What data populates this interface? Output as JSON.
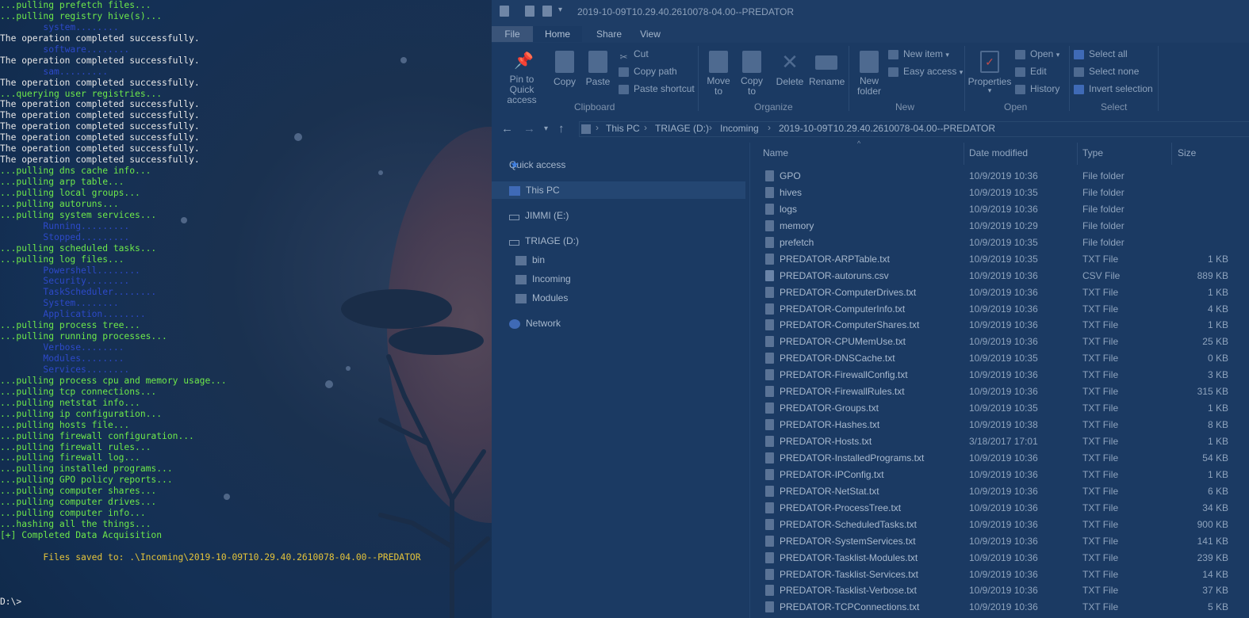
{
  "terminal": {
    "lines": [
      {
        "text": "...pulling prefetch files...",
        "color": "green"
      },
      {
        "text": "...pulling registry hive(s)...",
        "color": "green"
      },
      {
        "text": "        system........",
        "color": "blue"
      },
      {
        "text": "The operation completed successfully.",
        "color": "white"
      },
      {
        "text": "        software........",
        "color": "blue"
      },
      {
        "text": "The operation completed successfully.",
        "color": "white"
      },
      {
        "text": "        sam.........",
        "color": "blue"
      },
      {
        "text": "The operation completed successfully.",
        "color": "white"
      },
      {
        "text": "...querying user registries...",
        "color": "green"
      },
      {
        "text": "The operation completed successfully.",
        "color": "white"
      },
      {
        "text": "The operation completed successfully.",
        "color": "white"
      },
      {
        "text": "The operation completed successfully.",
        "color": "white"
      },
      {
        "text": "The operation completed successfully.",
        "color": "white"
      },
      {
        "text": "The operation completed successfully.",
        "color": "white"
      },
      {
        "text": "The operation completed successfully.",
        "color": "white"
      },
      {
        "text": "...pulling dns cache info...",
        "color": "green"
      },
      {
        "text": "...pulling arp table...",
        "color": "green"
      },
      {
        "text": "...pulling local groups...",
        "color": "green"
      },
      {
        "text": "...pulling autoruns...",
        "color": "green"
      },
      {
        "text": "...pulling system services...",
        "color": "green"
      },
      {
        "text": "        Running.........",
        "color": "blue"
      },
      {
        "text": "        Stopped.........",
        "color": "blue"
      },
      {
        "text": "...pulling scheduled tasks...",
        "color": "green"
      },
      {
        "text": "...pulling log files...",
        "color": "green"
      },
      {
        "text": "        Powershell........",
        "color": "blue"
      },
      {
        "text": "        Security........",
        "color": "blue"
      },
      {
        "text": "        TaskScheduler........",
        "color": "blue"
      },
      {
        "text": "        System........",
        "color": "blue"
      },
      {
        "text": "        Application........",
        "color": "blue"
      },
      {
        "text": "...pulling process tree...",
        "color": "green"
      },
      {
        "text": "...pulling running processes...",
        "color": "green"
      },
      {
        "text": "        Verbose........",
        "color": "blue"
      },
      {
        "text": "        Modules........",
        "color": "blue"
      },
      {
        "text": "        Services........",
        "color": "blue"
      },
      {
        "text": "...pulling process cpu and memory usage...",
        "color": "green"
      },
      {
        "text": "...pulling tcp connections...",
        "color": "green"
      },
      {
        "text": "...pulling netstat info...",
        "color": "green"
      },
      {
        "text": "...pulling ip configuration...",
        "color": "green"
      },
      {
        "text": "...pulling hosts file...",
        "color": "green"
      },
      {
        "text": "...pulling firewall configuration...",
        "color": "green"
      },
      {
        "text": "...pulling firewall rules...",
        "color": "green"
      },
      {
        "text": "...pulling firewall log...",
        "color": "green"
      },
      {
        "text": "...pulling installed programs...",
        "color": "green"
      },
      {
        "text": "...pulling GPO policy reports...",
        "color": "green"
      },
      {
        "text": "...pulling computer shares...",
        "color": "green"
      },
      {
        "text": "...pulling computer drives...",
        "color": "green"
      },
      {
        "text": "...pulling computer info...",
        "color": "green"
      },
      {
        "text": "...hashing all the things...",
        "color": "green"
      },
      {
        "text": "[+] Completed Data Acquisition",
        "color": "green"
      },
      {
        "text": "",
        "color": "white"
      },
      {
        "text": "        Files saved to: .\\Incoming\\2019-10-09T10.29.40.2610078-04.00--PREDATOR",
        "color": "yellow"
      },
      {
        "text": "",
        "color": "white"
      },
      {
        "text": "",
        "color": "white"
      },
      {
        "text": "",
        "color": "white"
      },
      {
        "text": "D:\\>",
        "color": "white"
      }
    ]
  },
  "explorer": {
    "title": "2019-10-09T10.29.40.2610078-04.00--PREDATOR",
    "tabs": {
      "file": "File",
      "home": "Home",
      "share": "Share",
      "view": "View"
    },
    "ribbon": {
      "pin": "Pin to Quick\naccess",
      "copy": "Copy",
      "paste": "Paste",
      "cut": "Cut",
      "copy_path": "Copy path",
      "paste_shortcut": "Paste shortcut",
      "move_to": "Move\nto",
      "copy_to": "Copy\nto",
      "delete": "Delete",
      "rename": "Rename",
      "new_folder": "New\nfolder",
      "new_item": "New item",
      "easy_access": "Easy access",
      "properties": "Properties",
      "open": "Open",
      "edit": "Edit",
      "history": "History",
      "select_all": "Select all",
      "select_none": "Select none",
      "invert_selection": "Invert selection",
      "groups": {
        "clipboard": "Clipboard",
        "organize": "Organize",
        "new": "New",
        "open": "Open",
        "select": "Select"
      }
    },
    "breadcrumb": [
      "This PC",
      "TRIAGE (D:)",
      "Incoming",
      "2019-10-09T10.29.40.2610078-04.00--PREDATOR"
    ],
    "nav": {
      "quick_access": "Quick access",
      "this_pc": "This PC",
      "jimmi": "JIMMI (E:)",
      "triage": "TRIAGE (D:)",
      "bin": "bin",
      "incoming": "Incoming",
      "modules": "Modules",
      "network": "Network"
    },
    "columns": {
      "name": "Name",
      "date": "Date modified",
      "type": "Type",
      "size": "Size"
    },
    "files": [
      {
        "name": "GPO",
        "date": "10/9/2019 10:36",
        "type": "File folder",
        "size": "",
        "kind": "folder"
      },
      {
        "name": "hives",
        "date": "10/9/2019 10:35",
        "type": "File folder",
        "size": "",
        "kind": "folder"
      },
      {
        "name": "logs",
        "date": "10/9/2019 10:36",
        "type": "File folder",
        "size": "",
        "kind": "folder"
      },
      {
        "name": "memory",
        "date": "10/9/2019 10:29",
        "type": "File folder",
        "size": "",
        "kind": "folder"
      },
      {
        "name": "prefetch",
        "date": "10/9/2019 10:35",
        "type": "File folder",
        "size": "",
        "kind": "folder"
      },
      {
        "name": "PREDATOR-ARPTable.txt",
        "date": "10/9/2019 10:35",
        "type": "TXT File",
        "size": "1 KB",
        "kind": "txt"
      },
      {
        "name": "PREDATOR-autoruns.csv",
        "date": "10/9/2019 10:36",
        "type": "CSV File",
        "size": "889 KB",
        "kind": "doc"
      },
      {
        "name": "PREDATOR-ComputerDrives.txt",
        "date": "10/9/2019 10:36",
        "type": "TXT File",
        "size": "1 KB",
        "kind": "txt"
      },
      {
        "name": "PREDATOR-ComputerInfo.txt",
        "date": "10/9/2019 10:36",
        "type": "TXT File",
        "size": "4 KB",
        "kind": "txt"
      },
      {
        "name": "PREDATOR-ComputerShares.txt",
        "date": "10/9/2019 10:36",
        "type": "TXT File",
        "size": "1 KB",
        "kind": "txt"
      },
      {
        "name": "PREDATOR-CPUMemUse.txt",
        "date": "10/9/2019 10:36",
        "type": "TXT File",
        "size": "25 KB",
        "kind": "txt"
      },
      {
        "name": "PREDATOR-DNSCache.txt",
        "date": "10/9/2019 10:35",
        "type": "TXT File",
        "size": "0 KB",
        "kind": "txt"
      },
      {
        "name": "PREDATOR-FirewallConfig.txt",
        "date": "10/9/2019 10:36",
        "type": "TXT File",
        "size": "3 KB",
        "kind": "txt"
      },
      {
        "name": "PREDATOR-FirewallRules.txt",
        "date": "10/9/2019 10:36",
        "type": "TXT File",
        "size": "315 KB",
        "kind": "txt"
      },
      {
        "name": "PREDATOR-Groups.txt",
        "date": "10/9/2019 10:35",
        "type": "TXT File",
        "size": "1 KB",
        "kind": "txt"
      },
      {
        "name": "PREDATOR-Hashes.txt",
        "date": "10/9/2019 10:38",
        "type": "TXT File",
        "size": "8 KB",
        "kind": "txt"
      },
      {
        "name": "PREDATOR-Hosts.txt",
        "date": "3/18/2017 17:01",
        "type": "TXT File",
        "size": "1 KB",
        "kind": "txt"
      },
      {
        "name": "PREDATOR-InstalledPrograms.txt",
        "date": "10/9/2019 10:36",
        "type": "TXT File",
        "size": "54 KB",
        "kind": "txt"
      },
      {
        "name": "PREDATOR-IPConfig.txt",
        "date": "10/9/2019 10:36",
        "type": "TXT File",
        "size": "1 KB",
        "kind": "txt"
      },
      {
        "name": "PREDATOR-NetStat.txt",
        "date": "10/9/2019 10:36",
        "type": "TXT File",
        "size": "6 KB",
        "kind": "txt"
      },
      {
        "name": "PREDATOR-ProcessTree.txt",
        "date": "10/9/2019 10:36",
        "type": "TXT File",
        "size": "34 KB",
        "kind": "txt"
      },
      {
        "name": "PREDATOR-ScheduledTasks.txt",
        "date": "10/9/2019 10:36",
        "type": "TXT File",
        "size": "900 KB",
        "kind": "txt"
      },
      {
        "name": "PREDATOR-SystemServices.txt",
        "date": "10/9/2019 10:36",
        "type": "TXT File",
        "size": "141 KB",
        "kind": "txt"
      },
      {
        "name": "PREDATOR-Tasklist-Modules.txt",
        "date": "10/9/2019 10:36",
        "type": "TXT File",
        "size": "239 KB",
        "kind": "txt"
      },
      {
        "name": "PREDATOR-Tasklist-Services.txt",
        "date": "10/9/2019 10:36",
        "type": "TXT File",
        "size": "14 KB",
        "kind": "txt"
      },
      {
        "name": "PREDATOR-Tasklist-Verbose.txt",
        "date": "10/9/2019 10:36",
        "type": "TXT File",
        "size": "37 KB",
        "kind": "txt"
      },
      {
        "name": "PREDATOR-TCPConnections.txt",
        "date": "10/9/2019 10:36",
        "type": "TXT File",
        "size": "5 KB",
        "kind": "txt"
      }
    ]
  }
}
